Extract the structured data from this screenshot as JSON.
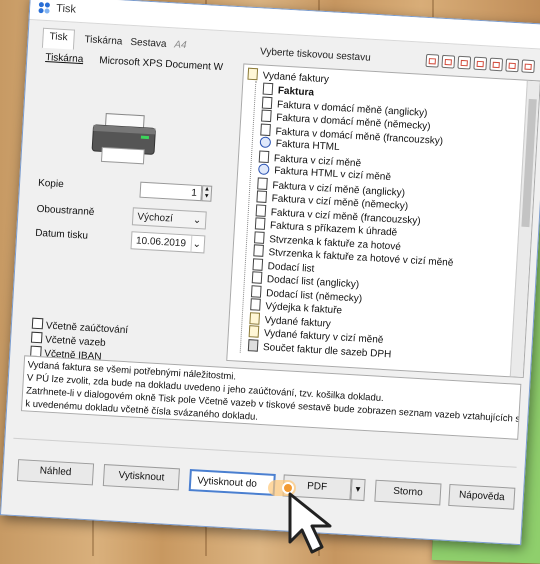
{
  "window": {
    "title": "Tisk"
  },
  "tabs": [
    {
      "label": "Tisk",
      "active": true,
      "disabled": false
    },
    {
      "label": "Tiskárna",
      "active": false,
      "disabled": false
    },
    {
      "label": "Sestava",
      "active": false,
      "disabled": false
    },
    {
      "label": "A4",
      "active": false,
      "disabled": true
    }
  ],
  "left": {
    "printer_label": "Tiskárna",
    "printer_name": "Microsoft XPS Document W",
    "copies_label": "Kopie",
    "copies_value": "1",
    "duplex_label": "Oboustranně",
    "duplex_value": "Výchozí",
    "date_label": "Datum tisku",
    "date_value": "10.06.2019",
    "checkboxes": [
      {
        "label": "Včetně zaúčtování",
        "checked": false
      },
      {
        "label": "Včetně vazeb",
        "checked": false
      },
      {
        "label": "Včetně IBAN",
        "checked": false
      }
    ]
  },
  "right": {
    "title": "Vyberte tiskovou sestavu",
    "toolbar_icons": [
      "doc-new-icon",
      "doc-copy-icon",
      "doc-edit-icon",
      "doc-delete-icon",
      "doc-import-icon",
      "doc-export-icon",
      "doc-help-icon"
    ],
    "root_label": "Vydané faktury",
    "items": [
      {
        "label": "Faktura",
        "kind": "doc",
        "selected": true
      },
      {
        "label": "Faktura v domácí měně (anglicky)",
        "kind": "doc"
      },
      {
        "label": "Faktura v domácí měně (německy)",
        "kind": "doc"
      },
      {
        "label": "Faktura v domácí měně (francouzsky)",
        "kind": "doc"
      },
      {
        "label": "Faktura HTML",
        "kind": "html"
      },
      {
        "label": "Faktura v cizí měně",
        "kind": "doc"
      },
      {
        "label": "Faktura HTML v cizí měně",
        "kind": "html"
      },
      {
        "label": "Faktura v cizí měně (anglicky)",
        "kind": "doc"
      },
      {
        "label": "Faktura v cizí měně (německy)",
        "kind": "doc"
      },
      {
        "label": "Faktura v cizí měně (francouzsky)",
        "kind": "doc"
      },
      {
        "label": "Faktura s příkazem k úhradě",
        "kind": "doc"
      },
      {
        "label": "Stvrzenka k faktuře za hotové",
        "kind": "doc"
      },
      {
        "label": "Stvrzenka k faktuře za hotové v cizí měně",
        "kind": "doc"
      },
      {
        "label": "Dodací list",
        "kind": "doc"
      },
      {
        "label": "Dodací list (anglicky)",
        "kind": "doc"
      },
      {
        "label": "Dodací list (německy)",
        "kind": "doc"
      },
      {
        "label": "Výdejka k faktuře",
        "kind": "doc"
      },
      {
        "label": "Vydané faktury",
        "kind": "list"
      },
      {
        "label": "Vydané faktury v cizí měně",
        "kind": "list"
      },
      {
        "label": "Součet faktur dle sazeb DPH",
        "kind": "sum"
      }
    ],
    "description": [
      "Vydaná faktura se všemi potřebnými náležitostmi.",
      "V PÚ lze zvolit, zda bude na dokladu uvedeno i jeho zaúčtování, tzv. košilka dokladu.",
      "Zatrhnete-li v dialogovém okně Tisk pole Včetně vazeb v tiskové sestavě bude zobrazen seznam vazeb vztahujících se",
      "k uvedenému dokladu včetně čísla svázaného dokladu."
    ]
  },
  "buttons": {
    "preview": "Náhled",
    "print": "Vytisknout",
    "print_to": "Vytisknout do",
    "pdf": "PDF",
    "cancel": "Storno",
    "help": "Nápověda"
  }
}
